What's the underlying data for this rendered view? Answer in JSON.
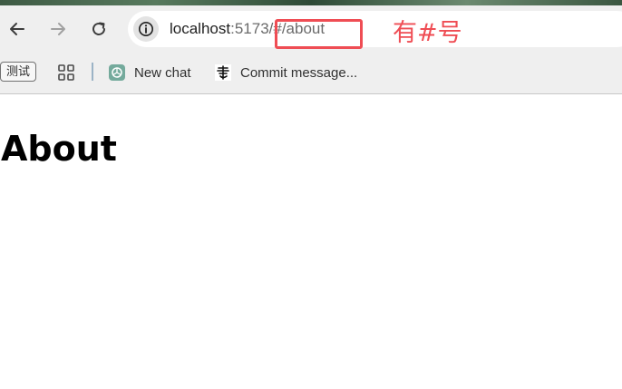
{
  "browser": {
    "address_bar": {
      "host": "localhost",
      "port": ":5173",
      "path": "/#/about"
    },
    "bookmarks": {
      "chip_label": "测试",
      "items": [
        {
          "label": "New chat",
          "icon": "chatgpt-icon"
        },
        {
          "label": "Commit message...",
          "icon": "calligraphy-icon"
        }
      ]
    }
  },
  "annotation": {
    "text": "有#号",
    "color": "#ef4d54"
  },
  "page": {
    "heading": "About"
  }
}
